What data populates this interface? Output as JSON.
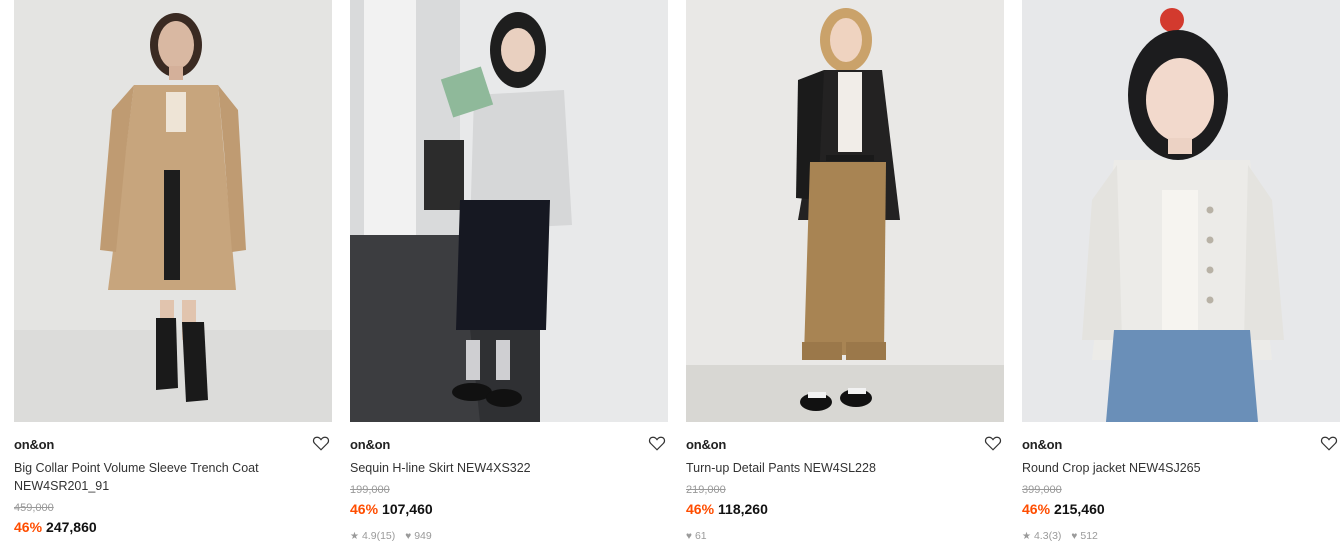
{
  "colors": {
    "discount": "#ff4d00",
    "price": "#111111",
    "strike": "#9a9a9a"
  },
  "products": [
    {
      "brand": "on&on",
      "title": "Big Collar Point Volume Sleeve Trench Coat NEW4SR201_91",
      "original_price": "459,000",
      "discount": "46%",
      "price": "247,860"
    },
    {
      "brand": "on&on",
      "title": "Sequin H-line Skirt NEW4XS322",
      "original_price": "199,000",
      "discount": "46%",
      "price": "107,460",
      "rating": "4.9",
      "reviews": "(15)",
      "likes": "949"
    },
    {
      "brand": "on&on",
      "title": "Turn-up Detail Pants NEW4SL228",
      "original_price": "219,000",
      "discount": "46%",
      "price": "118,260",
      "likes": "61"
    },
    {
      "brand": "on&on",
      "title": "Round Crop jacket NEW4SJ265",
      "original_price": "399,000",
      "discount": "46%",
      "price": "215,460",
      "rating": "4.3",
      "reviews": "(3)",
      "likes": "512"
    }
  ]
}
